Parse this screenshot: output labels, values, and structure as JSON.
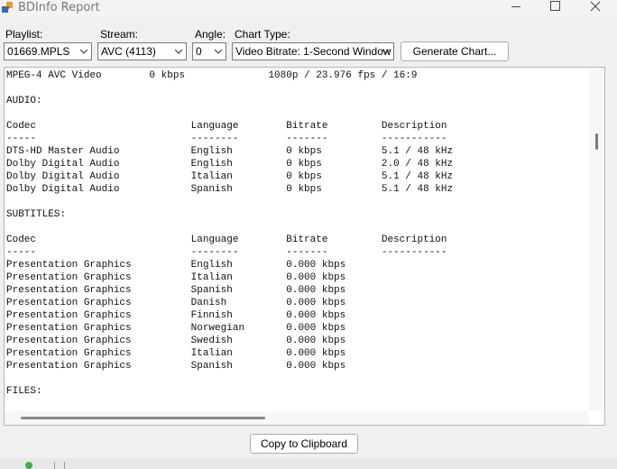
{
  "window": {
    "title": "BDInfo Report"
  },
  "toolbar": {
    "playlist_label": "Playlist:",
    "playlist_value": "01669.MPLS",
    "stream_label": "Stream:",
    "stream_value": "AVC (4113)",
    "angle_label": "Angle:",
    "angle_value": "0",
    "chart_type_label": "Chart Type:",
    "chart_type_value": "Video Bitrate: 1-Second Window",
    "generate_button": "Generate Chart..."
  },
  "report": {
    "lines": [
      "MPEG-4 AVC Video        0 kbps              1080p / 23.976 fps / 16:9",
      "",
      "AUDIO:",
      "",
      "Codec                          Language        Bitrate         Description",
      "-----                          --------        -------         -----------",
      "DTS-HD Master Audio            English         0 kbps          5.1 / 48 kHz",
      "Dolby Digital Audio            English         0 kbps          2.0 / 48 kHz",
      "Dolby Digital Audio            Italian         0 kbps          5.1 / 48 kHz",
      "Dolby Digital Audio            Spanish         0 kbps          5.1 / 48 kHz",
      "",
      "SUBTITLES:",
      "",
      "Codec                          Language        Bitrate         Description",
      "-----                          --------        -------         -----------",
      "Presentation Graphics          English         0.000 kbps",
      "Presentation Graphics          Italian         0.000 kbps",
      "Presentation Graphics          Spanish         0.000 kbps",
      "Presentation Graphics          Danish          0.000 kbps",
      "Presentation Graphics          Finnish         0.000 kbps",
      "Presentation Graphics          Norwegian       0.000 kbps",
      "Presentation Graphics          Swedish         0.000 kbps",
      "Presentation Graphics          Italian         0.000 kbps",
      "Presentation Graphics          Spanish         0.000 kbps",
      "",
      "FILES:"
    ]
  },
  "footer": {
    "copy_button": "Copy to Clipboard"
  },
  "icons": {
    "app": "bdinfo-app-icon",
    "minimize": "minimize-icon",
    "maximize": "maximize-icon",
    "close": "close-icon",
    "dropdown": "chevron-down-icon"
  },
  "colors": {
    "window_bg": "#f0f0f0",
    "text_bg": "#ffffff",
    "title_text": "#7a7a7a"
  }
}
